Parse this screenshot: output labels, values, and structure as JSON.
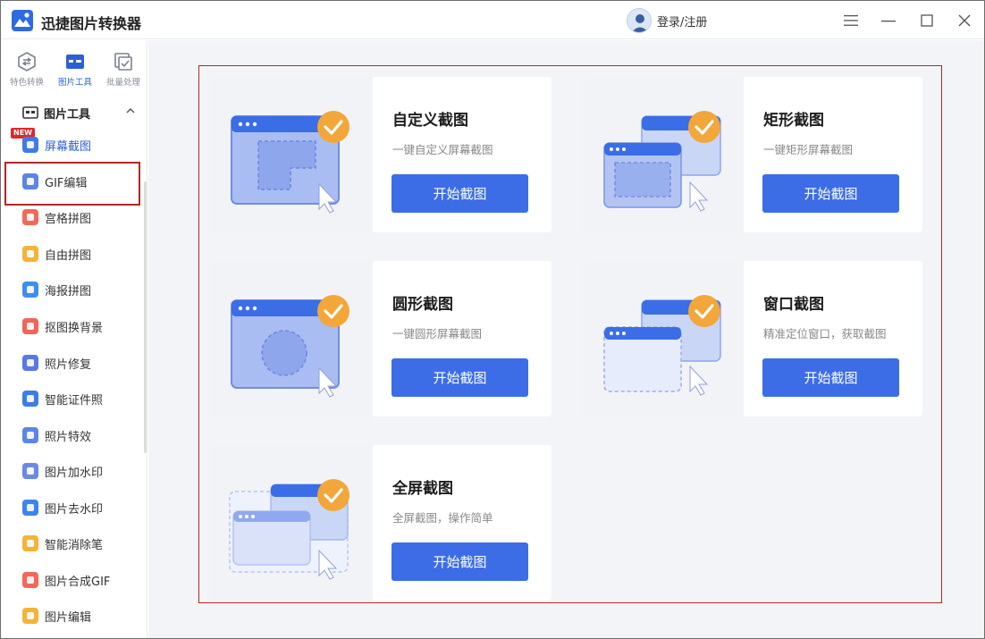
{
  "app": {
    "title": "迅捷图片转换器"
  },
  "header": {
    "user_label": "登录/注册"
  },
  "topnav": [
    {
      "label": "特色转换"
    },
    {
      "label": "图片工具"
    },
    {
      "label": "批量处理"
    }
  ],
  "sidebar": {
    "section_label": "图片工具",
    "new_badge": "NEW",
    "items": [
      {
        "label": "屏幕截图",
        "color": "#3f7ae8"
      },
      {
        "label": "GIF编辑",
        "color": "#5b86e5"
      },
      {
        "label": "宫格拼图",
        "color": "#f06a5a"
      },
      {
        "label": "自由拼图",
        "color": "#f3b43a"
      },
      {
        "label": "海报拼图",
        "color": "#3d8ff0"
      },
      {
        "label": "抠图换背景",
        "color": "#f0655a"
      },
      {
        "label": "照片修复",
        "color": "#5a78e6"
      },
      {
        "label": "智能证件照",
        "color": "#3a7ee8"
      },
      {
        "label": "照片特效",
        "color": "#5b86e5"
      },
      {
        "label": "图片加水印",
        "color": "#6a8ae8"
      },
      {
        "label": "图片去水印",
        "color": "#3b85ee"
      },
      {
        "label": "智能消除笔",
        "color": "#f3b43a"
      },
      {
        "label": "图片合成GIF",
        "color": "#f06a5a"
      },
      {
        "label": "图片编辑",
        "color": "#f3b43a"
      }
    ]
  },
  "cards": [
    {
      "title": "自定义截图",
      "desc": "一键自定义屏幕截图",
      "button": "开始截图"
    },
    {
      "title": "矩形截图",
      "desc": "一键矩形屏幕截图",
      "button": "开始截图"
    },
    {
      "title": "圆形截图",
      "desc": "一键圆形屏幕截图",
      "button": "开始截图"
    },
    {
      "title": "窗口截图",
      "desc": "精准定位窗口，获取截图",
      "button": "开始截图"
    },
    {
      "title": "全屏截图",
      "desc": "全屏截图，操作简单",
      "button": "开始截图"
    }
  ],
  "colors": {
    "accent": "#3c6de6",
    "highlight_border": "#b32626",
    "check_badge": "#f3a63a"
  }
}
